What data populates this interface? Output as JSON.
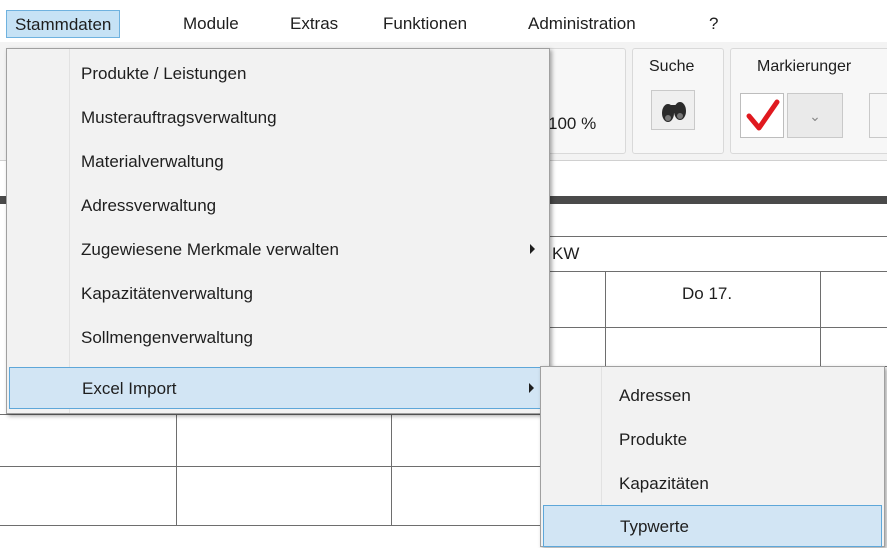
{
  "menubar": {
    "items": [
      {
        "label": "Stammdaten"
      },
      {
        "label": "Module"
      },
      {
        "label": "Extras"
      },
      {
        "label": "Funktionen"
      },
      {
        "label": "Administration"
      },
      {
        "label": "?"
      }
    ]
  },
  "ribbon": {
    "zoom": "100 %",
    "search_label": "Suche",
    "markings_label": "Markierunger",
    "search_icon": "binoculars-icon",
    "check_icon": "checkmark-icon",
    "accent_check": "#e0191f"
  },
  "grid": {
    "kw_label": "KW",
    "day_label": "Do 17."
  },
  "stammdaten_menu": {
    "items": [
      {
        "label": "Produkte / Leistungen"
      },
      {
        "label": "Musterauftragsverwaltung"
      },
      {
        "label": "Materialverwaltung"
      },
      {
        "label": "Adressverwaltung"
      },
      {
        "label": "Zugewiesene Merkmale verwalten"
      },
      {
        "label": "Kapazitätenverwaltung"
      },
      {
        "label": "Sollmengenverwaltung"
      },
      {
        "label": "Excel Import"
      }
    ]
  },
  "excel_import_menu": {
    "items": [
      {
        "label": "Adressen"
      },
      {
        "label": "Produkte"
      },
      {
        "label": "Kapazitäten"
      },
      {
        "label": "Typwerte"
      }
    ]
  }
}
